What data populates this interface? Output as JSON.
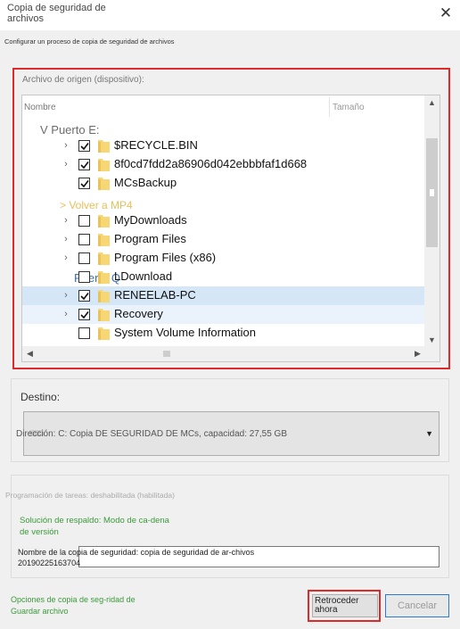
{
  "window": {
    "title": "Copia de seguridad de archivos",
    "close_symbol": "✕"
  },
  "subtitle": "Configurar un proceso de copia de seguridad de archivos",
  "source": {
    "label": "Archivo de origen (dispositivo):",
    "columns": {
      "name": "Nombre",
      "size": "Tamaño"
    },
    "labels": {
      "drive": "V Puerto E:",
      "back": "> Volver a MP4",
      "port": "Puerto Q"
    },
    "items": [
      {
        "name": "$RECYCLE.BIN",
        "checked": true,
        "expandable": true
      },
      {
        "name": "8f0cd7fdd2a86906d042ebbbfaf1d668",
        "checked": true,
        "expandable": true
      },
      {
        "name": "MCsBackup",
        "checked": true,
        "expandable": false
      },
      {
        "name": "MyDownloads",
        "checked": false,
        "expandable": true
      },
      {
        "name": "Program Files",
        "checked": false,
        "expandable": true
      },
      {
        "name": "Program Files (x86)",
        "checked": false,
        "expandable": true
      },
      {
        "name": "LDownload",
        "checked": false,
        "expandable": false
      },
      {
        "name": "RENEELAB-PC",
        "checked": true,
        "expandable": true,
        "selected": true
      },
      {
        "name": "Recovery",
        "checked": true,
        "expandable": true
      },
      {
        "name": "System Volume Information",
        "checked": false,
        "expandable": false
      }
    ]
  },
  "destination": {
    "label": "Destino:",
    "selected": "Dirección: C: Copia DE SEGURIDAD DE MCs, capacidad: 27,55 GB"
  },
  "schedule": {
    "text": "Programación de tareas: deshabilitada (habilitada)",
    "scheme": "Solución de respaldo: Modo de ca-dena de versión",
    "name_label": "Nombre de la",
    "name_value": "Nombre de la copia de seguridad: copia de seguridad de ar-chivos 20190225163704"
  },
  "footer": {
    "options_link": "Opciones de copia de seg-ridad de Guardar archivo",
    "back_button": "Retroceder ahora",
    "cancel_button": "Cancelar"
  },
  "colors": {
    "highlight_border": "#e02a2a",
    "selected_row": "#d5e6f6",
    "link_green": "#3a9a3a",
    "folder_yellow": "#f7d774"
  }
}
